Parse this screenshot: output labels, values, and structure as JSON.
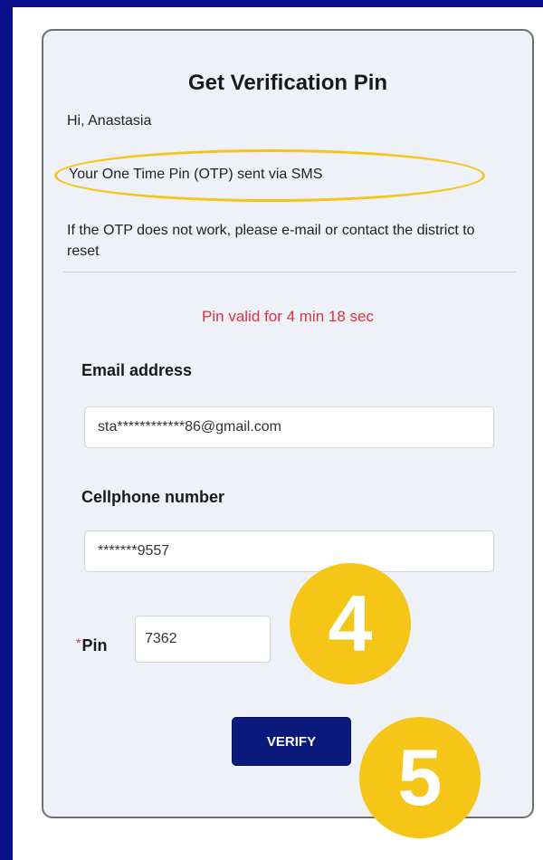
{
  "dialog": {
    "title": "Get Verification Pin",
    "greeting": "Hi, Anastasia",
    "otp_notice": "Your One Time Pin (OTP) sent via SMS",
    "help_text": "If the OTP does not work, please e-mail or contact the district to reset",
    "validity": "Pin valid for 4 min 18 sec"
  },
  "form": {
    "email_label": "Email address",
    "email_value": "sta************86@gmail.com",
    "phone_label": "Cellphone number",
    "phone_value": "*******9557",
    "pin_required_mark": "*",
    "pin_label": "Pin",
    "pin_value": "7362",
    "verify_label": "VERIFY"
  },
  "annotations": {
    "step_4": "4",
    "step_5": "5"
  },
  "colors": {
    "background": "#0a0f8a",
    "highlight": "#f5c518",
    "validity_text": "#e0313d",
    "button": "#0a1a7a"
  }
}
